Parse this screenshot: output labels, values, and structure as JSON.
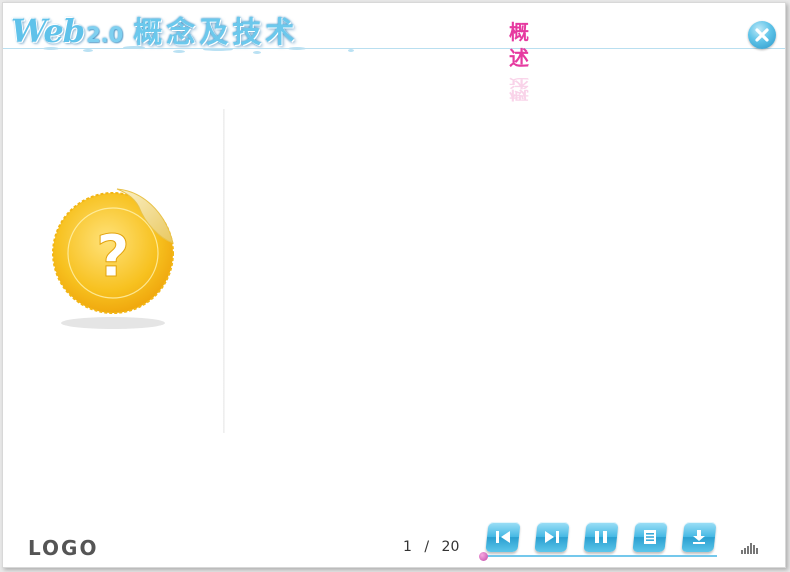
{
  "header": {
    "title_web": "Web",
    "title_version": "2.0",
    "title_cn": "概念及技术",
    "section_title": "概 述",
    "close_icon": "close-circle-icon"
  },
  "content": {
    "badge_icon": "question-sticker-icon",
    "badge_colors": {
      "gold": "#f7c11f",
      "light": "#ffe27a",
      "peel": "#f5e6a8"
    }
  },
  "footer": {
    "logo": "LOGO",
    "page_current": "1",
    "page_separator": "/",
    "page_total": "20",
    "progress_fraction": 0.0,
    "buttons": [
      {
        "name": "first-page-button",
        "icon": "skip-back-icon"
      },
      {
        "name": "next-page-button",
        "icon": "skip-forward-icon"
      },
      {
        "name": "pause-button",
        "icon": "pause-icon"
      },
      {
        "name": "contents-button",
        "icon": "list-icon"
      },
      {
        "name": "download-button",
        "icon": "download-icon"
      }
    ],
    "volume_icon": "volume-bars-icon"
  },
  "colors": {
    "accent_blue": "#45b8e4",
    "section_pink": "#e63aa0",
    "knob_pink": "#c04aa8"
  }
}
